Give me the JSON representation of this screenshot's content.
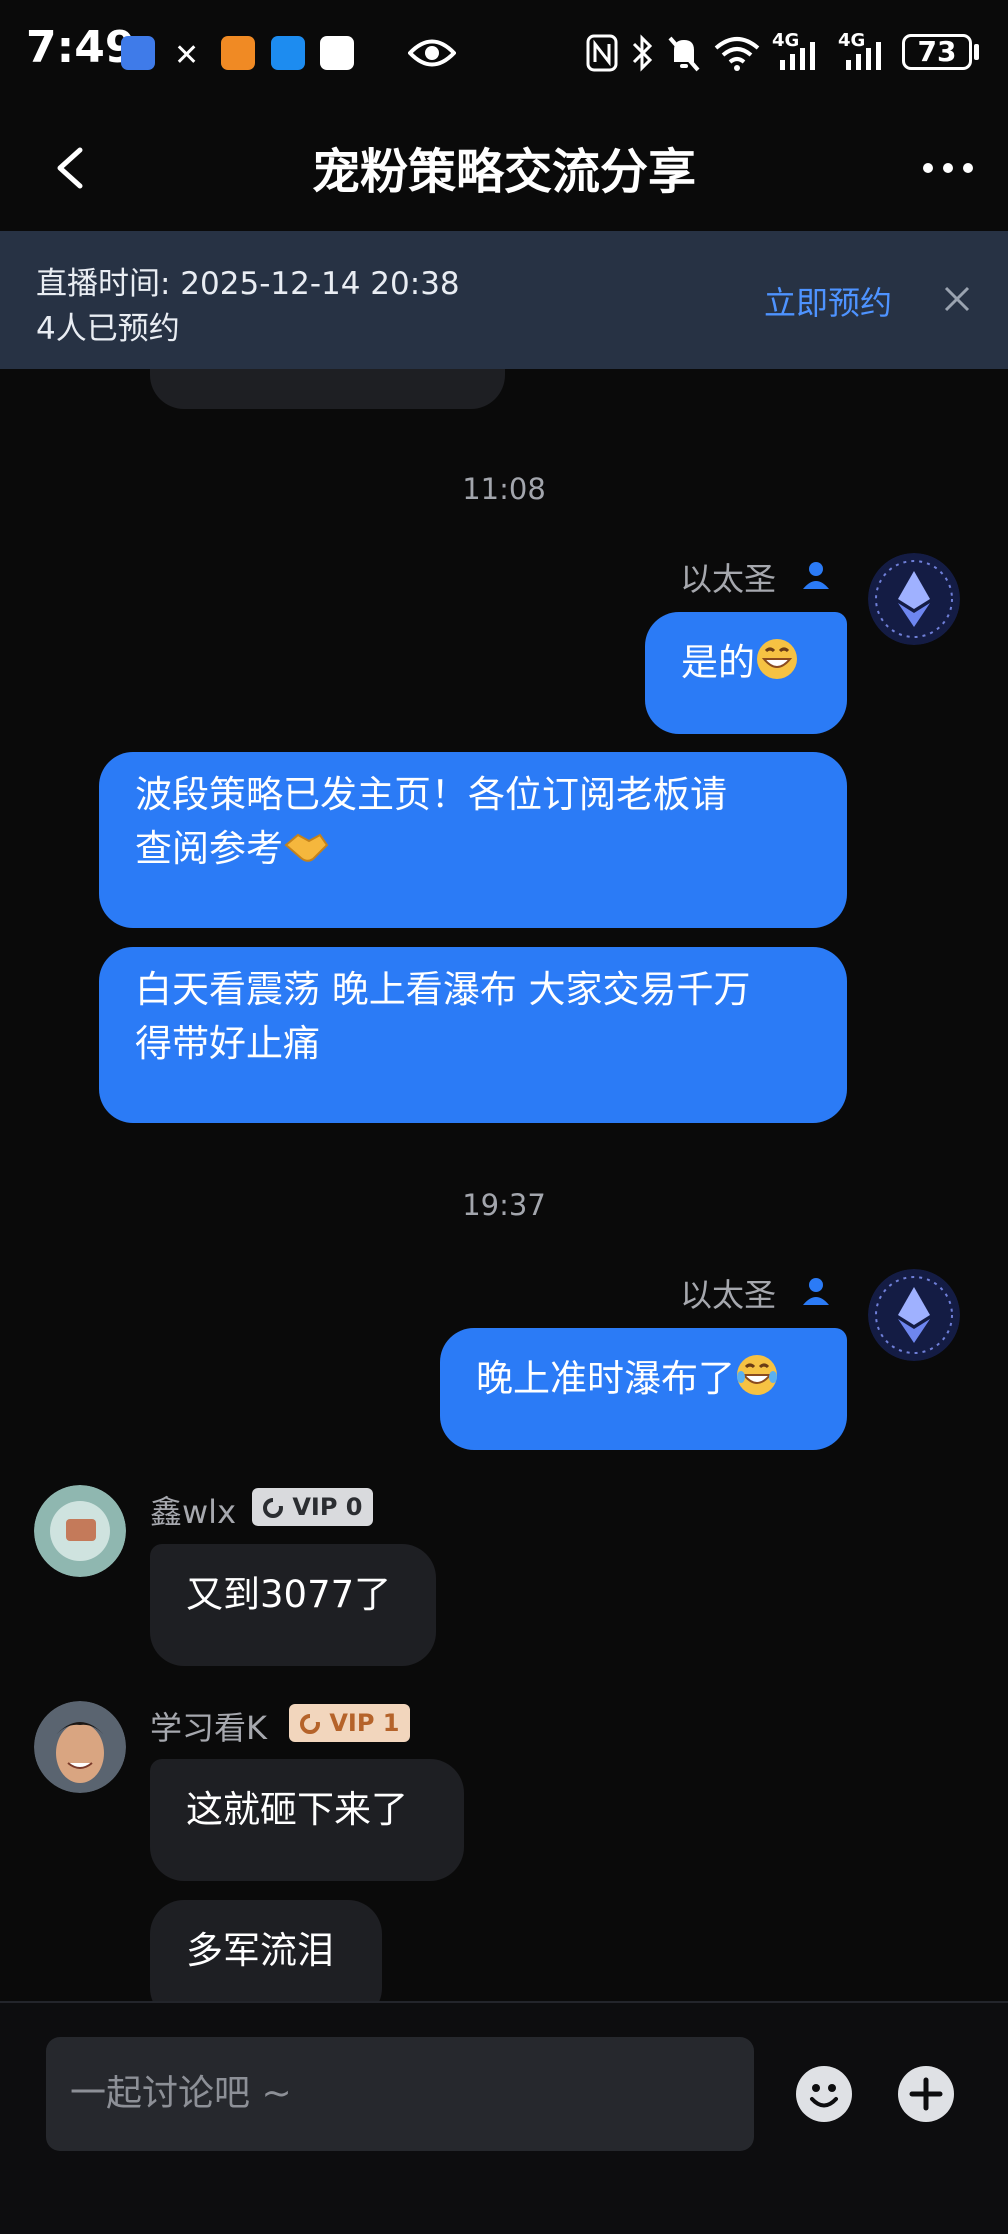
{
  "status_bar": {
    "time": "7:49",
    "battery": "73",
    "network_1": "4G",
    "network_2": "4G"
  },
  "header": {
    "title": "宠粉策略交流分享",
    "back_icon": "chevron-left-icon",
    "more_icon": "more-dots-icon"
  },
  "banner": {
    "live_time": "直播时间: 2025-12-14 20:38",
    "reserved_count": "4人已预约",
    "reserve_label": "立即预约",
    "close_icon": "close-icon"
  },
  "chat": {
    "timestamps": [
      "11:08",
      "19:37"
    ],
    "outgoing_sender": "以太圣",
    "messages_out": [
      "是的",
      "波段策略已发主页！各位订阅老板请",
      "查阅参考",
      "白天看震荡 晚上看瀑布 大家交易千万",
      "得带好止痛",
      "晚上准时瀑布了"
    ],
    "incoming": [
      {
        "name": "鑫wlx",
        "badge": "VIP 0",
        "messages": [
          "又到3077了"
        ]
      },
      {
        "name": "学习看K",
        "badge": "VIP 1",
        "messages": [
          "这就砸下来了",
          "多军流泪"
        ]
      }
    ]
  },
  "input": {
    "placeholder": "一起讨论吧 ~"
  },
  "colors": {
    "accent_blue": "#2b7bf6",
    "banner_bg": "#273244",
    "link_blue": "#4e93ff"
  }
}
